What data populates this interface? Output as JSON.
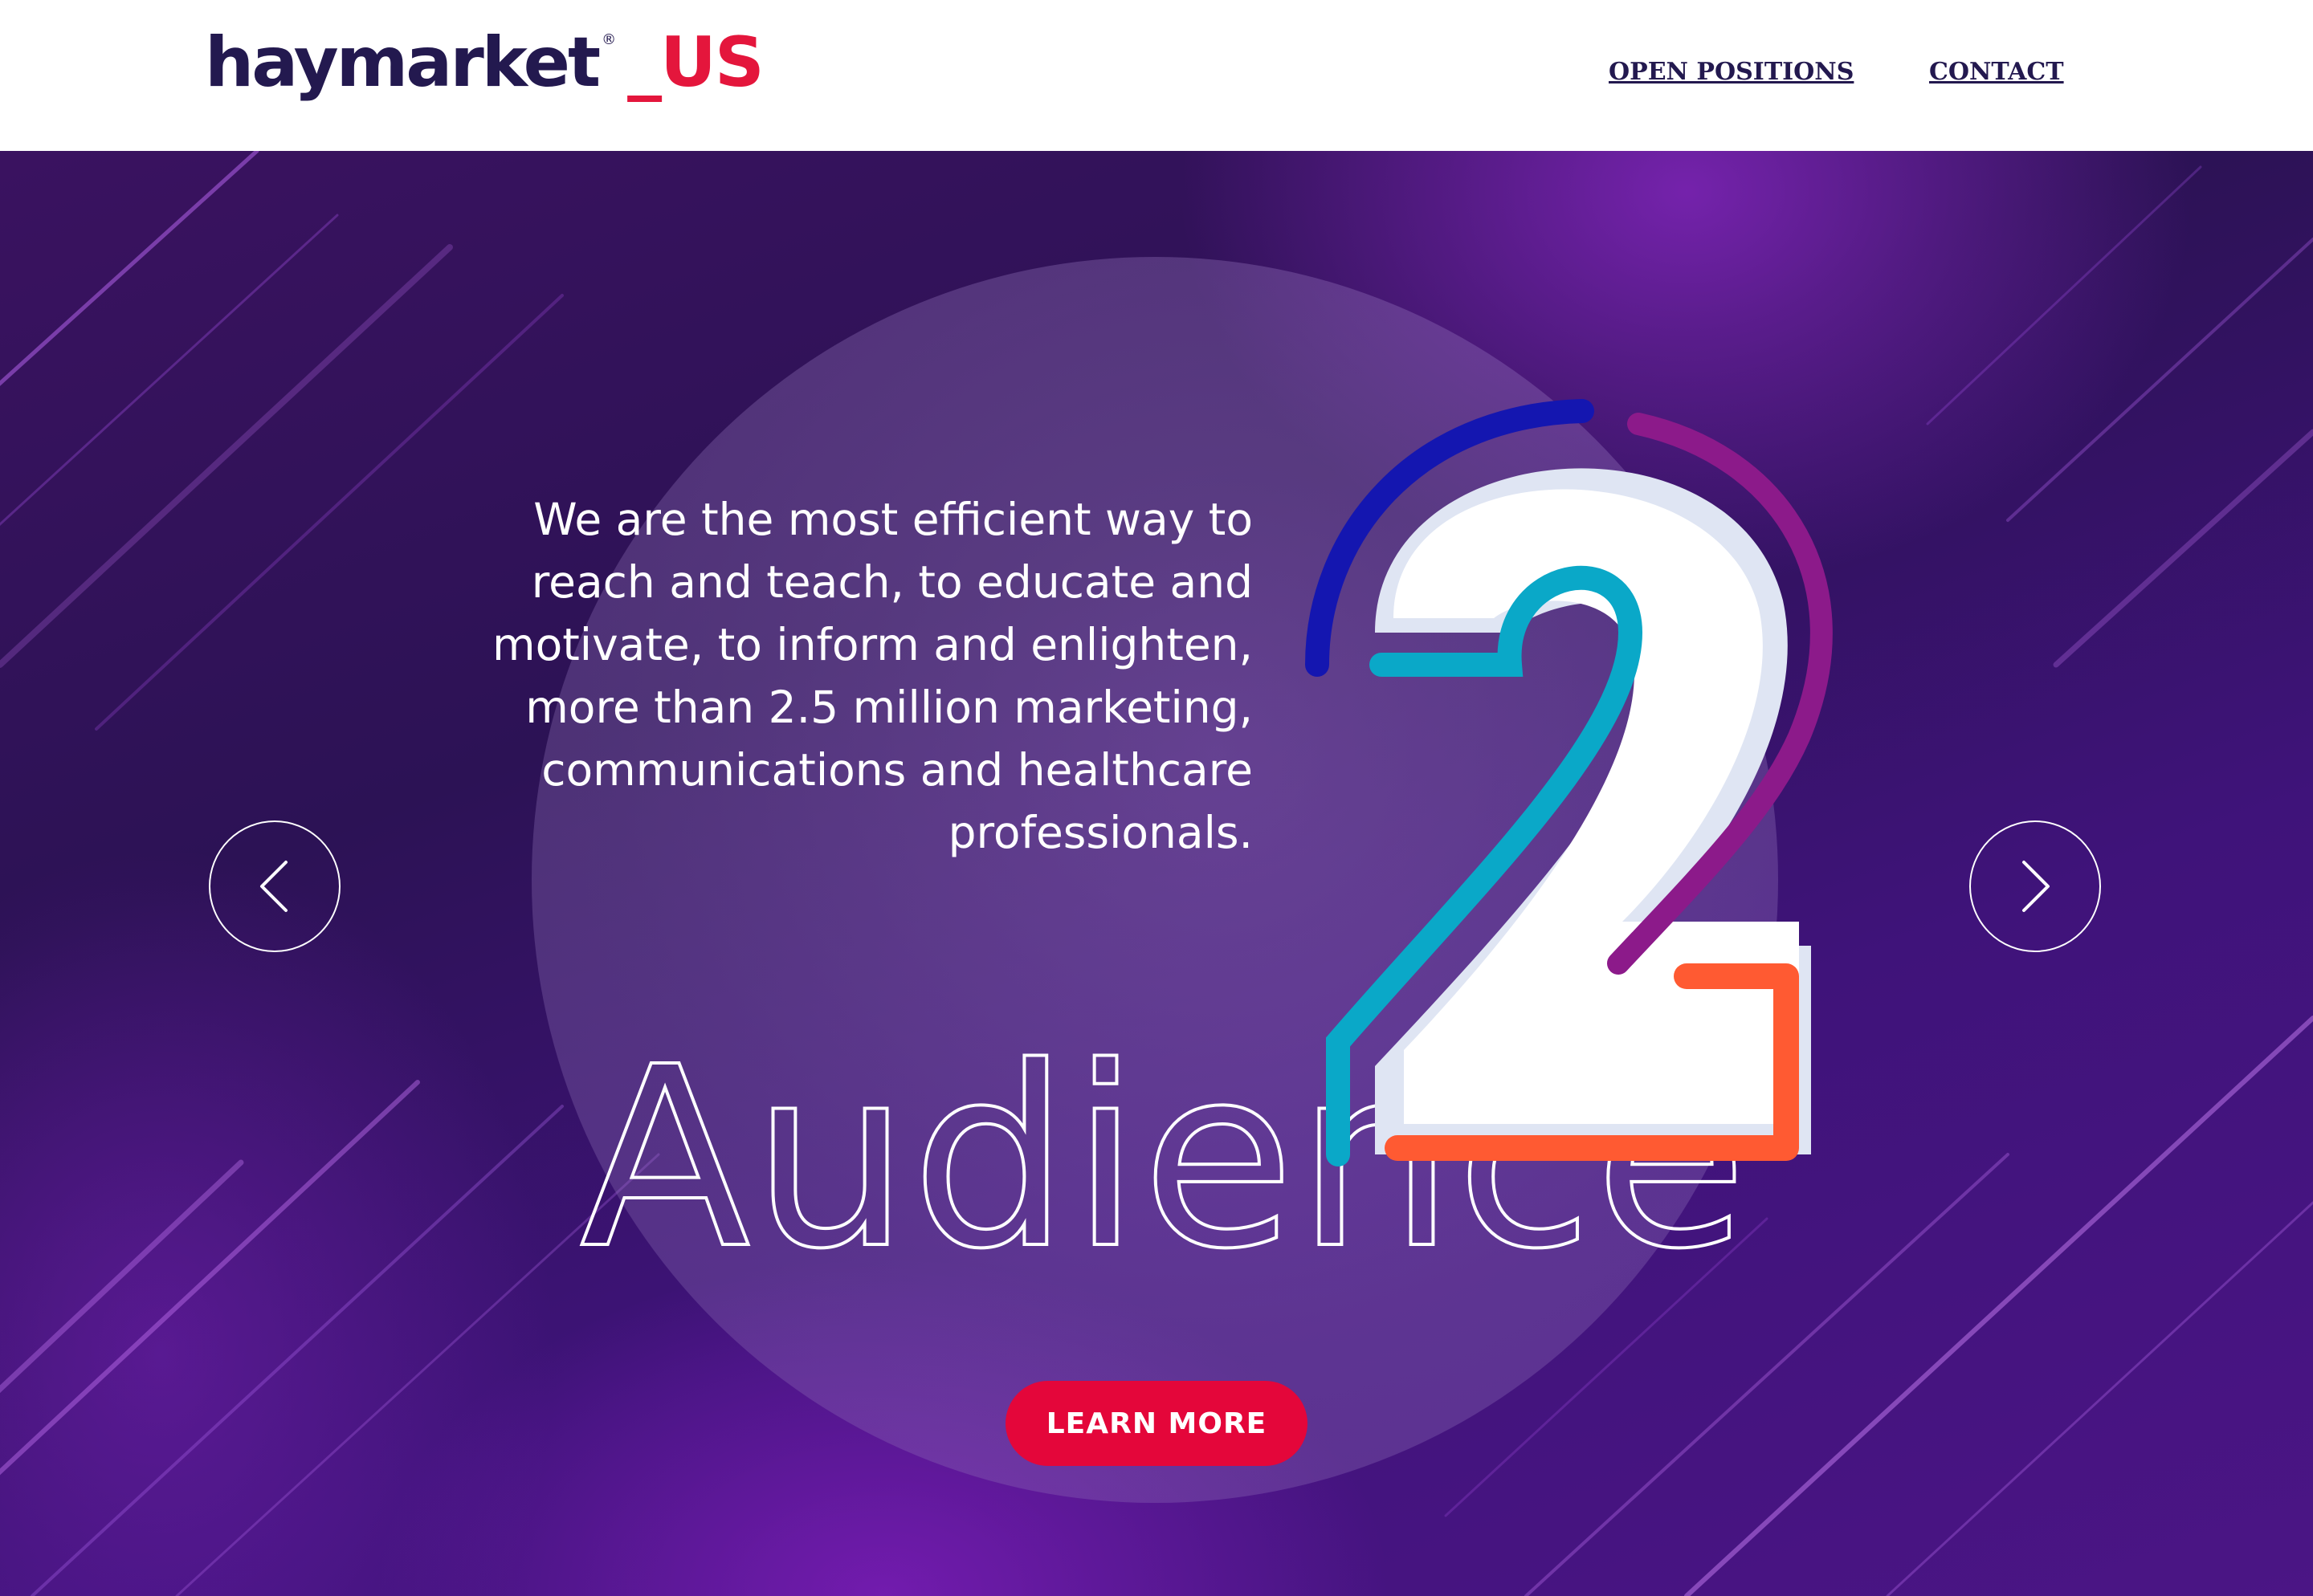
{
  "header": {
    "logo": {
      "word": "haymarket",
      "registered": "®",
      "suffix": "_US"
    },
    "nav": [
      {
        "label": "OPEN POSITIONS"
      },
      {
        "label": "CONTACT"
      }
    ]
  },
  "hero": {
    "slide_number": "2",
    "tagline": "We are the most efficient way to reach and teach, to educate and motivate, to inform and enlighten, more than 2.5 million marketing, communications and healthcare professionals.",
    "heading": "Audience",
    "cta_label": "LEARN MORE",
    "icons": {
      "previous": "chevron-left-icon",
      "next": "chevron-right-icon"
    },
    "colors": {
      "accent": "#e4063a",
      "brand_navy": "#23194f",
      "brand_red": "#e4163c",
      "stroke_blue": "#1416b0",
      "stroke_teal": "#0aa8c8",
      "stroke_magenta": "#8c1a8a",
      "stroke_orange": "#ff5a32"
    }
  }
}
